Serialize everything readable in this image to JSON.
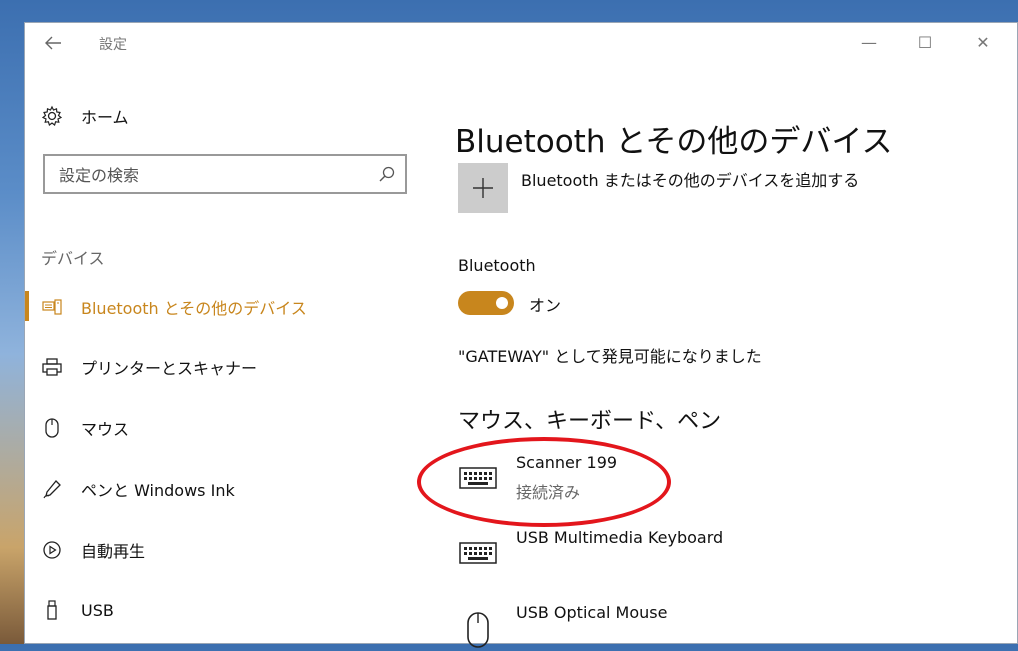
{
  "window": {
    "title": "設定"
  },
  "titlebar": {
    "back_icon": "arrow-left-icon",
    "minimize_glyph": "—",
    "maximize_glyph": "☐",
    "close_glyph": "✕"
  },
  "sidebar": {
    "home_label": "ホーム",
    "search_placeholder": "設定の検索",
    "section_label": "デバイス",
    "accent_color": "#c8861d",
    "items": [
      {
        "label": "Bluetooth とその他のデバイス",
        "icon": "bluetooth-devices-icon",
        "active": true
      },
      {
        "label": "プリンターとスキャナー",
        "icon": "printer-icon",
        "active": false
      },
      {
        "label": "マウス",
        "icon": "mouse-icon",
        "active": false
      },
      {
        "label": "ペンと Windows Ink",
        "icon": "pen-icon",
        "active": false
      },
      {
        "label": "自動再生",
        "icon": "autoplay-icon",
        "active": false
      },
      {
        "label": "USB",
        "icon": "usb-icon",
        "active": false
      }
    ]
  },
  "main": {
    "title": "Bluetooth とその他のデバイス",
    "add_device_label": "Bluetooth またはその他のデバイスを追加する",
    "bluetooth_label": "Bluetooth",
    "toggle_state": "オン",
    "toggle_on": true,
    "discoverable_text": "\"GATEWAY\" として発見可能になりました",
    "group_heading": "マウス、キーボード、ペン",
    "devices": [
      {
        "name": "Scanner 199",
        "status": "接続済み",
        "icon": "keyboard-icon"
      },
      {
        "name": "USB Multimedia Keyboard",
        "icon": "keyboard-icon"
      },
      {
        "name": "USB Optical Mouse",
        "icon": "mouse-icon"
      }
    ]
  },
  "annotation": {
    "color": "#e3161c"
  }
}
